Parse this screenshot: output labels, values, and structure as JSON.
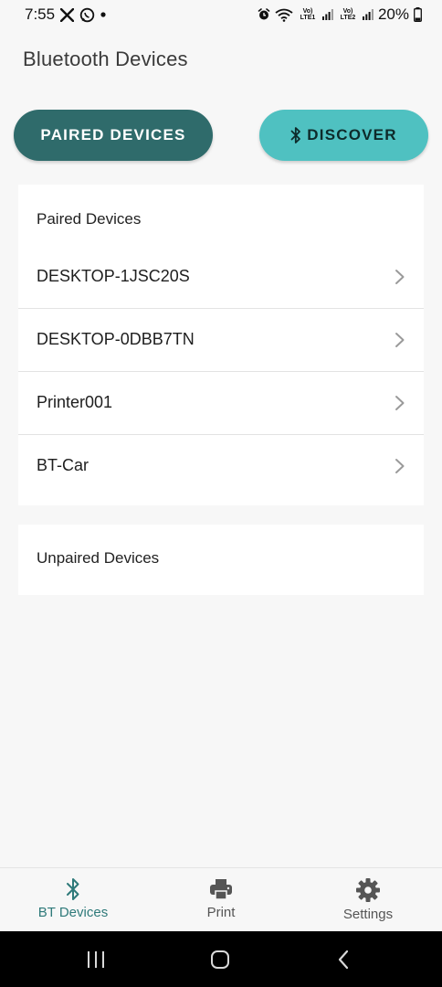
{
  "status_bar": {
    "time": "7:55",
    "notification_icons": [
      "x-logo-icon",
      "whatsapp-icon",
      "dot-icon"
    ],
    "right_icons": [
      "alarm-icon",
      "wifi-icon",
      "signal-icon",
      "signal-icon"
    ],
    "lte1_label": "Vo) LTE1",
    "lte2_label": "Vo) LTE2",
    "battery": "20%"
  },
  "header": {
    "title": "Bluetooth Devices"
  },
  "actions": {
    "paired_label": "PAIRED DEVICES",
    "discover_label": "DISCOVER"
  },
  "paired_section": {
    "title": "Paired Devices",
    "devices": [
      {
        "name": "DESKTOP-1JSC20S"
      },
      {
        "name": "DESKTOP-0DBB7TN"
      },
      {
        "name": "Printer001"
      },
      {
        "name": "BT-Car"
      }
    ]
  },
  "unpaired_section": {
    "title": "Unpaired Devices"
  },
  "bottom_nav": {
    "items": [
      {
        "label": "BT Devices",
        "icon": "bluetooth-icon",
        "active": true
      },
      {
        "label": "Print",
        "icon": "printer-icon",
        "active": false
      },
      {
        "label": "Settings",
        "icon": "gear-icon",
        "active": false
      }
    ]
  },
  "colors": {
    "primary_dark": "#2f6b6b",
    "primary_light": "#4fc1c1",
    "background": "#f7f7f7",
    "card": "#ffffff"
  }
}
